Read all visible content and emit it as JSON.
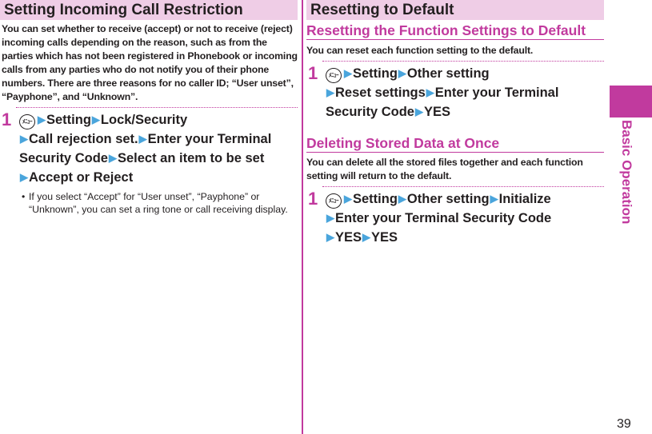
{
  "left": {
    "section_title": "Setting Incoming Call Restriction",
    "description": "You can set whether to receive (accept) or not to receive (reject) incoming calls depending on the reason, such as from the parties which has not been registered in Phonebook or incoming calls from any parties who do not notify you of their phone numbers. There are three reasons for no caller ID; “User unset”, “Payphone”, and “Unknown”.",
    "step": {
      "number": "1",
      "menu_key": "ﾒﾆｭｰ",
      "items": [
        "Setting",
        "Lock/Security",
        "Call rejection set.",
        "Enter your Terminal Security Code",
        "Select an item to be set",
        "Accept or Reject"
      ]
    },
    "note": "If you select “Accept” for “User unset”, “Payphone” or “Unknown”, you can set a ring tone or call receiving display."
  },
  "right": {
    "section_title": "Resetting to Default",
    "sub1": {
      "title": "Resetting the Function Settings to Default",
      "description": "You can reset each function setting to the default.",
      "step": {
        "number": "1",
        "menu_key": "ﾒﾆｭｰ",
        "items": [
          "Setting",
          "Other setting",
          "Reset settings",
          "Enter your Terminal Security Code",
          "YES"
        ]
      }
    },
    "sub2": {
      "title": "Deleting Stored Data at Once",
      "description": "You can delete all the stored files together and each function setting will return to the default.",
      "step": {
        "number": "1",
        "menu_key": "ﾒﾆｭｰ",
        "items": [
          "Setting",
          "Other setting",
          "Initialize",
          "Enter your Terminal Security Code",
          "YES",
          "YES"
        ]
      }
    }
  },
  "side_tab": {
    "label": "Basic Operation"
  },
  "page_number": "39",
  "colors": {
    "accent": "#c13a9e",
    "header_bg": "#efcde6",
    "arrow": "#4aa5dc"
  },
  "icons": {
    "arrow": "▶"
  }
}
